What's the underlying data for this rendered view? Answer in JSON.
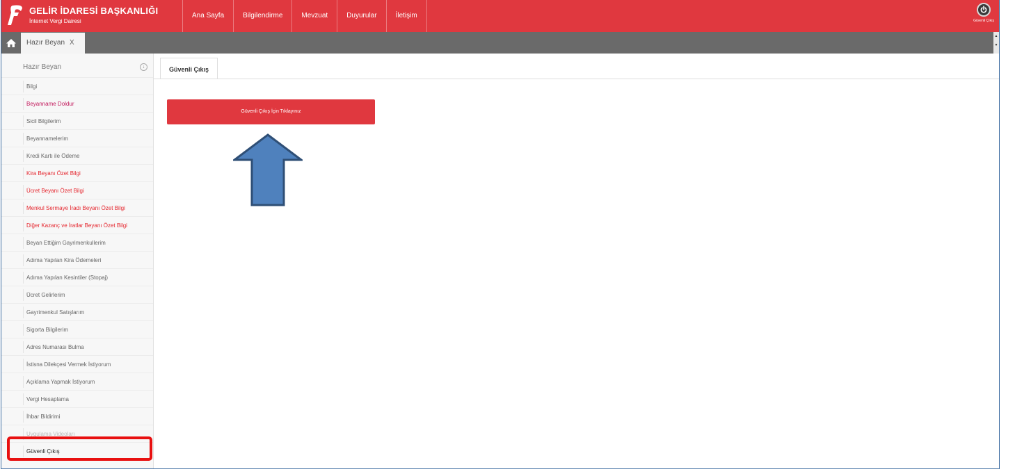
{
  "header": {
    "title": "GELİR İDARESİ BAŞKANLIĞI",
    "subtitle": "İnternet Vergi Dairesi",
    "nav": [
      {
        "label": "Ana Sayfa"
      },
      {
        "label": "Bilgilendirme"
      },
      {
        "label": "Mevzuat"
      },
      {
        "label": "Duyurular"
      },
      {
        "label": "İletişim"
      }
    ],
    "logout_label": "Güvenli Çıkış",
    "logout_icon": "power-icon",
    "brand_color": "#e0383f"
  },
  "tabs": {
    "home_icon": "home-icon",
    "open_tab": {
      "label": "Hazır Beyan",
      "close": "X"
    }
  },
  "sidebar": {
    "title": "Hazır Beyan",
    "toggle_icon": "circle-arrow-icon",
    "toggle_glyph": "↓",
    "items": [
      {
        "label": "Bilgi"
      },
      {
        "label": "Beyanname Doldur"
      },
      {
        "label": "Sicil Bilgilerim"
      },
      {
        "label": "Beyannamelerim"
      },
      {
        "label": "Kredi Kartı ile Ödeme"
      },
      {
        "label": "Kira Beyanı Özet Bilgi"
      },
      {
        "label": "Ücret Beyanı Özet Bilgi"
      },
      {
        "label": "Menkul Sermaye İradı Beyanı Özet Bilgi"
      },
      {
        "label": "Diğer Kazanç ve İratlar Beyanı Özet Bilgi"
      },
      {
        "label": "Beyan Ettiğim Gayrimenkullerim"
      },
      {
        "label": "Adıma Yapılan Kira Ödemeleri"
      },
      {
        "label": "Adıma Yapılan Kesintiler (Stopaj)"
      },
      {
        "label": "Ücret Gelirlerim"
      },
      {
        "label": "Gayrimenkul Satışlarım"
      },
      {
        "label": "Sigorta Bilgilerim"
      },
      {
        "label": "Adres Numarası Bulma"
      },
      {
        "label": "İstisna Dilekçesi Vermek İstiyorum"
      },
      {
        "label": "Açıklama Yapmak İstiyorum"
      },
      {
        "label": "Vergi Hesaplama"
      },
      {
        "label": "İhbar Bildirimi"
      },
      {
        "label": "Uygulama Videoları"
      },
      {
        "label": "Güvenli Çıkış"
      }
    ]
  },
  "content": {
    "tab_label": "Güvenli Çıkış",
    "button_label": "Güvenli Çıkış İçin Tıklayınız",
    "annotation": {
      "arrow_color": "#4f81bd",
      "highlight_color": "#e81010"
    }
  }
}
